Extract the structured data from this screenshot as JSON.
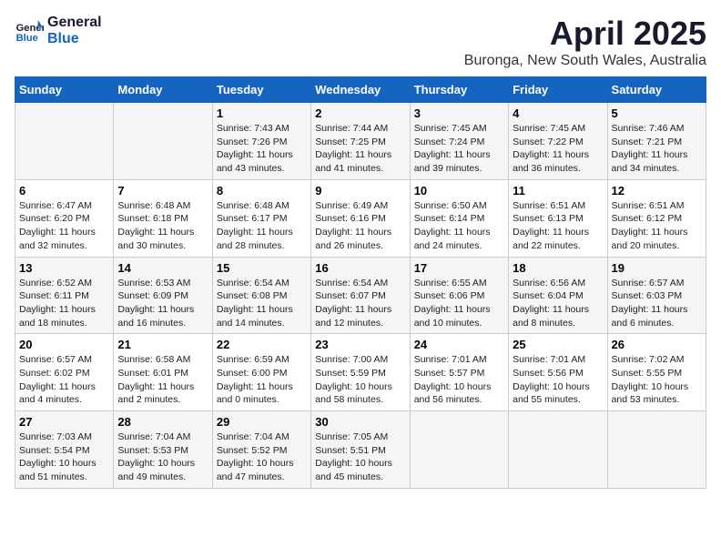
{
  "header": {
    "logo_line1": "General",
    "logo_line2": "Blue",
    "month": "April 2025",
    "location": "Buronga, New South Wales, Australia"
  },
  "weekdays": [
    "Sunday",
    "Monday",
    "Tuesday",
    "Wednesday",
    "Thursday",
    "Friday",
    "Saturday"
  ],
  "weeks": [
    [
      {
        "day": "",
        "info": ""
      },
      {
        "day": "",
        "info": ""
      },
      {
        "day": "1",
        "info": "Sunrise: 7:43 AM\nSunset: 7:26 PM\nDaylight: 11 hours and 43 minutes."
      },
      {
        "day": "2",
        "info": "Sunrise: 7:44 AM\nSunset: 7:25 PM\nDaylight: 11 hours and 41 minutes."
      },
      {
        "day": "3",
        "info": "Sunrise: 7:45 AM\nSunset: 7:24 PM\nDaylight: 11 hours and 39 minutes."
      },
      {
        "day": "4",
        "info": "Sunrise: 7:45 AM\nSunset: 7:22 PM\nDaylight: 11 hours and 36 minutes."
      },
      {
        "day": "5",
        "info": "Sunrise: 7:46 AM\nSunset: 7:21 PM\nDaylight: 11 hours and 34 minutes."
      }
    ],
    [
      {
        "day": "6",
        "info": "Sunrise: 6:47 AM\nSunset: 6:20 PM\nDaylight: 11 hours and 32 minutes."
      },
      {
        "day": "7",
        "info": "Sunrise: 6:48 AM\nSunset: 6:18 PM\nDaylight: 11 hours and 30 minutes."
      },
      {
        "day": "8",
        "info": "Sunrise: 6:48 AM\nSunset: 6:17 PM\nDaylight: 11 hours and 28 minutes."
      },
      {
        "day": "9",
        "info": "Sunrise: 6:49 AM\nSunset: 6:16 PM\nDaylight: 11 hours and 26 minutes."
      },
      {
        "day": "10",
        "info": "Sunrise: 6:50 AM\nSunset: 6:14 PM\nDaylight: 11 hours and 24 minutes."
      },
      {
        "day": "11",
        "info": "Sunrise: 6:51 AM\nSunset: 6:13 PM\nDaylight: 11 hours and 22 minutes."
      },
      {
        "day": "12",
        "info": "Sunrise: 6:51 AM\nSunset: 6:12 PM\nDaylight: 11 hours and 20 minutes."
      }
    ],
    [
      {
        "day": "13",
        "info": "Sunrise: 6:52 AM\nSunset: 6:11 PM\nDaylight: 11 hours and 18 minutes."
      },
      {
        "day": "14",
        "info": "Sunrise: 6:53 AM\nSunset: 6:09 PM\nDaylight: 11 hours and 16 minutes."
      },
      {
        "day": "15",
        "info": "Sunrise: 6:54 AM\nSunset: 6:08 PM\nDaylight: 11 hours and 14 minutes."
      },
      {
        "day": "16",
        "info": "Sunrise: 6:54 AM\nSunset: 6:07 PM\nDaylight: 11 hours and 12 minutes."
      },
      {
        "day": "17",
        "info": "Sunrise: 6:55 AM\nSunset: 6:06 PM\nDaylight: 11 hours and 10 minutes."
      },
      {
        "day": "18",
        "info": "Sunrise: 6:56 AM\nSunset: 6:04 PM\nDaylight: 11 hours and 8 minutes."
      },
      {
        "day": "19",
        "info": "Sunrise: 6:57 AM\nSunset: 6:03 PM\nDaylight: 11 hours and 6 minutes."
      }
    ],
    [
      {
        "day": "20",
        "info": "Sunrise: 6:57 AM\nSunset: 6:02 PM\nDaylight: 11 hours and 4 minutes."
      },
      {
        "day": "21",
        "info": "Sunrise: 6:58 AM\nSunset: 6:01 PM\nDaylight: 11 hours and 2 minutes."
      },
      {
        "day": "22",
        "info": "Sunrise: 6:59 AM\nSunset: 6:00 PM\nDaylight: 11 hours and 0 minutes."
      },
      {
        "day": "23",
        "info": "Sunrise: 7:00 AM\nSunset: 5:59 PM\nDaylight: 10 hours and 58 minutes."
      },
      {
        "day": "24",
        "info": "Sunrise: 7:01 AM\nSunset: 5:57 PM\nDaylight: 10 hours and 56 minutes."
      },
      {
        "day": "25",
        "info": "Sunrise: 7:01 AM\nSunset: 5:56 PM\nDaylight: 10 hours and 55 minutes."
      },
      {
        "day": "26",
        "info": "Sunrise: 7:02 AM\nSunset: 5:55 PM\nDaylight: 10 hours and 53 minutes."
      }
    ],
    [
      {
        "day": "27",
        "info": "Sunrise: 7:03 AM\nSunset: 5:54 PM\nDaylight: 10 hours and 51 minutes."
      },
      {
        "day": "28",
        "info": "Sunrise: 7:04 AM\nSunset: 5:53 PM\nDaylight: 10 hours and 49 minutes."
      },
      {
        "day": "29",
        "info": "Sunrise: 7:04 AM\nSunset: 5:52 PM\nDaylight: 10 hours and 47 minutes."
      },
      {
        "day": "30",
        "info": "Sunrise: 7:05 AM\nSunset: 5:51 PM\nDaylight: 10 hours and 45 minutes."
      },
      {
        "day": "",
        "info": ""
      },
      {
        "day": "",
        "info": ""
      },
      {
        "day": "",
        "info": ""
      }
    ]
  ]
}
